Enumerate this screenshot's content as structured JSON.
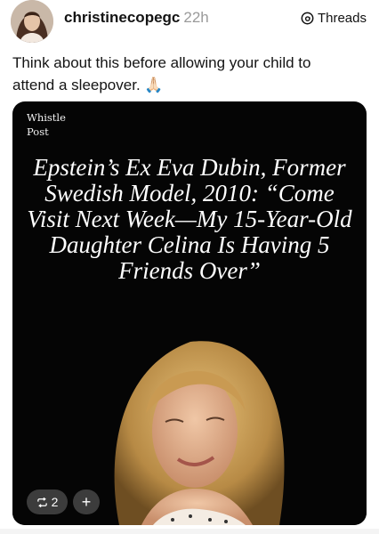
{
  "post": {
    "username": "christinecopegc",
    "time_ago": "22h",
    "platform_label": "Threads",
    "caption": "Think about this before allowing your child to attend a sleepover. 🙏🏻"
  },
  "media": {
    "source_line1": "Whistle",
    "source_line2": "Post",
    "headline": "Epstein’s Ex Eva Dubin, Former Swedish Model, 2010: “Come Visit Next Week—My 15-Year-Old Daughter Celina Is Having 5 Friends Over”",
    "repost_count": "2",
    "add_label": "+"
  },
  "icons": {
    "platform": "threads-logo-icon",
    "repost": "repost-icon",
    "add": "plus-icon"
  },
  "colors": {
    "media_background": "#050505",
    "pill_background": "#464646",
    "time_gray": "#9a9a9a"
  }
}
